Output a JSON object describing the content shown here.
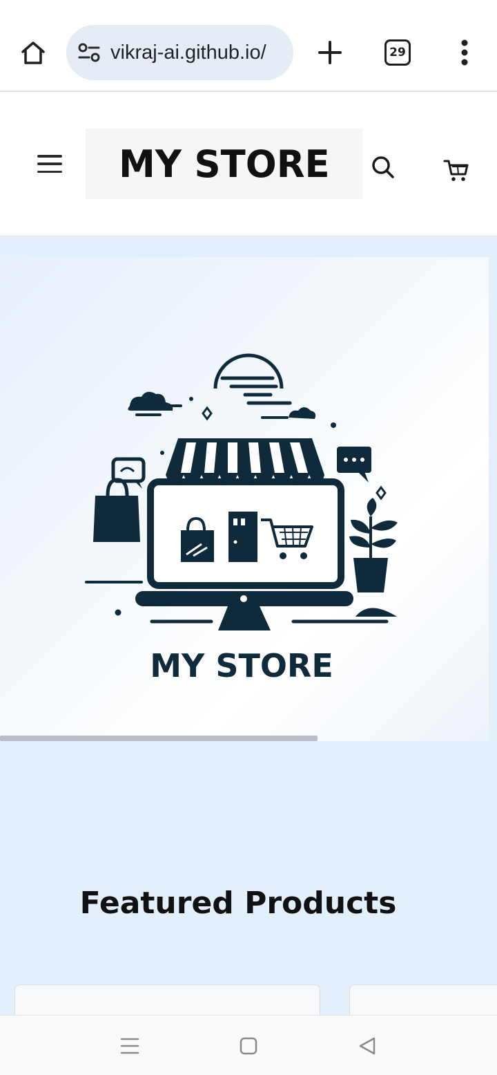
{
  "browser": {
    "url": "vikraj-ai.github.io/",
    "tab_count": "29",
    "icons": {
      "home": "home-icon",
      "site_settings": "tune-icon",
      "new_tab": "plus-icon",
      "menu": "more-vert-icon"
    }
  },
  "header": {
    "logo_text": "MY STORE",
    "icons": {
      "menu": "hamburger-icon",
      "search": "search-icon",
      "cart": "cart-icon"
    }
  },
  "hero": {
    "image_caption": "MY STORE",
    "scroll_progress": 0.65
  },
  "featured": {
    "title": "Featured Products"
  },
  "system_nav": {
    "icons": [
      "recent-apps-icon",
      "home-icon",
      "back-icon"
    ]
  },
  "colors": {
    "page_background": "#e3effb",
    "text_dark": "#111111",
    "url_pill": "#e6ecf6",
    "art_navy": "#0f2a3a"
  }
}
